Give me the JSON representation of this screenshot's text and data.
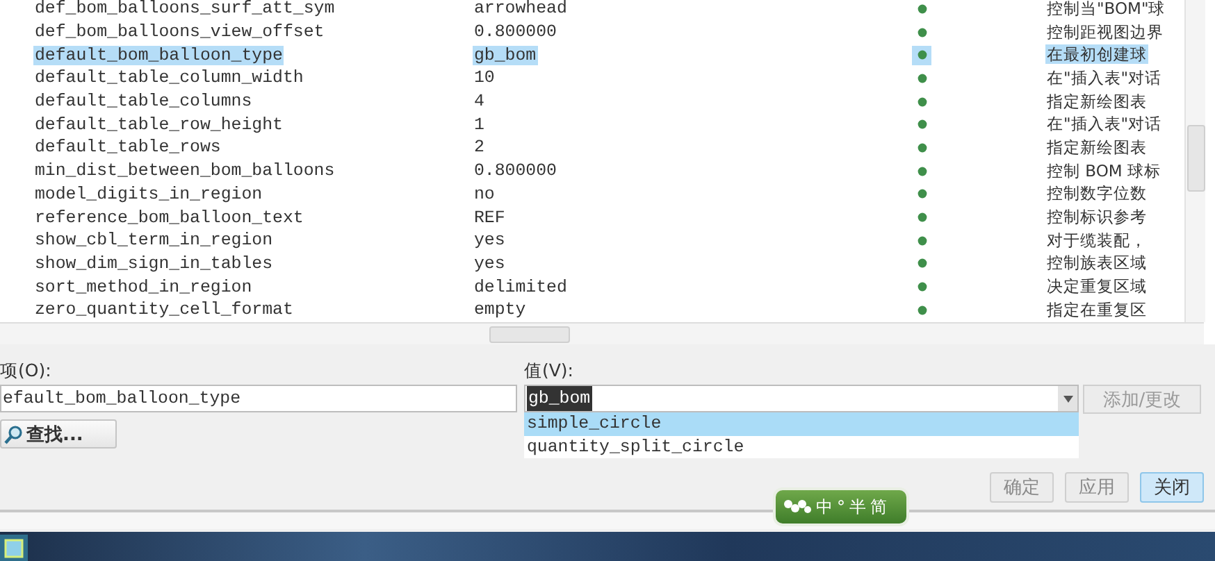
{
  "table": {
    "rows": [
      {
        "name": "def_bom_balloons_surf_att_sym",
        "value": "arrowhead",
        "description": "控制当\"BOM\"球",
        "selected": false
      },
      {
        "name": "def_bom_balloons_view_offset",
        "value": "0.800000",
        "description": "控制距视图边界",
        "selected": false
      },
      {
        "name": "default_bom_balloon_type",
        "value": "gb_bom",
        "description": "在最初创建球",
        "selected": true
      },
      {
        "name": "default_table_column_width",
        "value": "10",
        "description": "在\"插入表\"对话",
        "selected": false
      },
      {
        "name": "default_table_columns",
        "value": "4",
        "description": "指定新绘图表",
        "selected": false
      },
      {
        "name": "default_table_row_height",
        "value": "1",
        "description": "在\"插入表\"对话",
        "selected": false
      },
      {
        "name": "default_table_rows",
        "value": "2",
        "description": "指定新绘图表",
        "selected": false
      },
      {
        "name": "min_dist_between_bom_balloons",
        "value": "0.800000",
        "description": "控制 BOM 球标",
        "selected": false
      },
      {
        "name": "model_digits_in_region",
        "value": "no",
        "description": "控制数字位数",
        "selected": false
      },
      {
        "name": "reference_bom_balloon_text",
        "value": "REF",
        "description": "控制标识参考",
        "selected": false
      },
      {
        "name": "show_cbl_term_in_region",
        "value": "yes",
        "description": "对于缆装配，",
        "selected": false
      },
      {
        "name": "show_dim_sign_in_tables",
        "value": "yes",
        "description": "控制族表区域",
        "selected": false
      },
      {
        "name": "sort_method_in_region",
        "value": "delimited",
        "description": "决定重复区域",
        "selected": false
      },
      {
        "name": "zero_quantity_cell_format",
        "value": "empty",
        "description": "指定在重复区",
        "selected": false
      }
    ]
  },
  "editor": {
    "option_label": "项(O):",
    "option_value": "efault_bom_balloon_type",
    "find_button": "查找...",
    "value_label": "值(V):",
    "value": "gb_bom",
    "dropdown": [
      {
        "label": "simple_circle",
        "selected": true
      },
      {
        "label": "quantity_split_circle",
        "selected": false
      }
    ],
    "add_button": {
      "label": "添加/更改",
      "disabled": true
    }
  },
  "buttons": [
    {
      "label": "确定",
      "default": false
    },
    {
      "label": "应用",
      "default": false
    },
    {
      "label": "关闭",
      "default": true
    }
  ],
  "ime_bar": {
    "items": [
      "中",
      "°",
      "半",
      "简"
    ]
  }
}
